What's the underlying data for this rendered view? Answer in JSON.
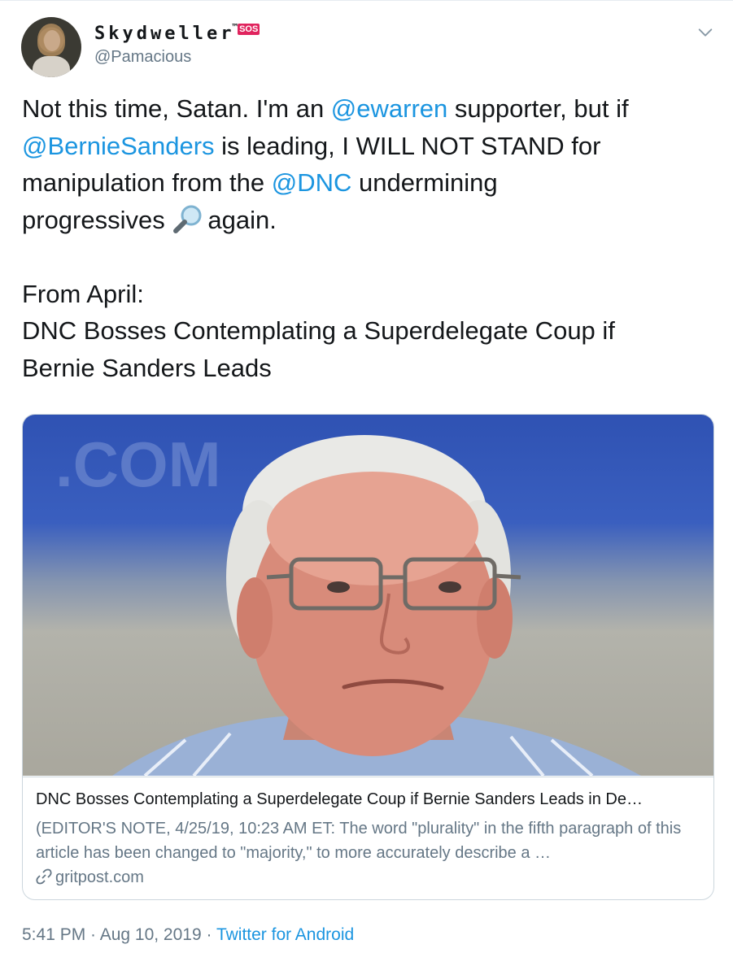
{
  "tweet": {
    "display_name": "Skydweller",
    "name_suffix": "™",
    "badge": "SOS",
    "handle": "@Pamacious",
    "text_parts": {
      "p1": "Not this time, Satan. I'm an ",
      "m1": "@ewarren",
      "p2": " supporter, but if\n",
      "m2": "@BernieSanders",
      "p3": " is leading, I WILL NOT STAND for\nmanipulation from the ",
      "m3": "@DNC",
      "p4": " undermining\nprogressives ",
      "p5": "again.\n\nFrom April:\nDNC Bosses Contemplating a Superdelegate Coup if\nBernie Sanders Leads"
    },
    "emoji": "magnifying-glass-tilted-right",
    "card": {
      "title": "DNC Bosses Contemplating a Superdelegate Coup if Bernie Sanders Leads in De…",
      "description": "(EDITOR'S NOTE, 4/25/19, 10:23 AM ET: The word \"plurality\" in the fifth paragraph of this article has been changed to \"majority,\" to more accurately describe a …",
      "domain": "gritpost.com",
      "image_text": ".COM"
    },
    "timestamp": "5:41 PM · Aug 10, 2019 · ",
    "source": "Twitter for Android"
  },
  "colors": {
    "link": "#1b95e0",
    "secondary_text": "#657786",
    "primary_text": "#14171a",
    "badge": "#e0245e"
  },
  "icons": [
    "avatar",
    "chevron-down-icon",
    "magnifying-glass-icon",
    "link-icon"
  ]
}
